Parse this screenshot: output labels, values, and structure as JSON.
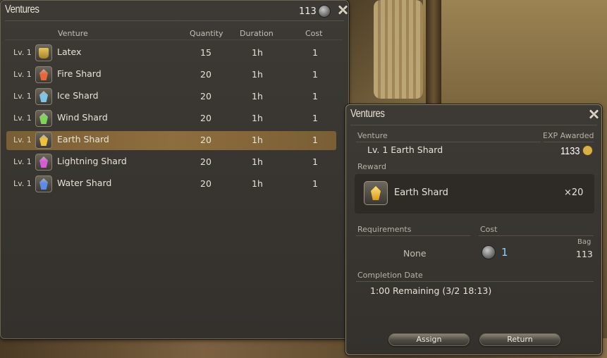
{
  "list_window": {
    "title": "Ventures",
    "gil": "113",
    "columns": {
      "venture": "Venture",
      "quantity": "Quantity",
      "duration": "Duration",
      "cost": "Cost"
    },
    "rows": [
      {
        "level": "Lv. 1",
        "name": "Latex",
        "quantity": "15",
        "duration": "1h",
        "cost": "1",
        "icon": "latex-icon",
        "color": "#d4b548",
        "selected": false
      },
      {
        "level": "Lv. 1",
        "name": "Fire Shard",
        "quantity": "20",
        "duration": "1h",
        "cost": "1",
        "icon": "fire-shard-icon",
        "color": "#e8673a",
        "selected": false
      },
      {
        "level": "Lv. 1",
        "name": "Ice Shard",
        "quantity": "20",
        "duration": "1h",
        "cost": "1",
        "icon": "ice-shard-icon",
        "color": "#7cc6e8",
        "selected": false
      },
      {
        "level": "Lv. 1",
        "name": "Wind Shard",
        "quantity": "20",
        "duration": "1h",
        "cost": "1",
        "icon": "wind-shard-icon",
        "color": "#7fd45a",
        "selected": false
      },
      {
        "level": "Lv. 1",
        "name": "Earth Shard",
        "quantity": "20",
        "duration": "1h",
        "cost": "1",
        "icon": "earth-shard-icon",
        "color": "#f0c03a",
        "selected": true
      },
      {
        "level": "Lv. 1",
        "name": "Lightning Shard",
        "quantity": "20",
        "duration": "1h",
        "cost": "1",
        "icon": "lightning-shard-icon",
        "color": "#d65ad6",
        "selected": false
      },
      {
        "level": "Lv. 1",
        "name": "Water Shard",
        "quantity": "20",
        "duration": "1h",
        "cost": "1",
        "icon": "water-shard-icon",
        "color": "#5a8ce8",
        "selected": false
      }
    ]
  },
  "detail_window": {
    "title": "Ventures",
    "venture_label": "Venture",
    "venture_value": "Lv. 1 Earth Shard",
    "exp_label": "EXP Awarded",
    "exp_value": "1133",
    "reward_label": "Reward",
    "reward_item": "Earth Shard",
    "reward_qty": "×20",
    "requirements_label": "Requirements",
    "requirements_value": "None",
    "cost_label": "Cost",
    "cost_value": "1",
    "bag_label": "Bag",
    "bag_value": "113",
    "completion_label": "Completion Date",
    "completion_value": "1:00 Remaining (3/2 18:13)",
    "assign_button": "Assign",
    "return_button": "Return"
  }
}
